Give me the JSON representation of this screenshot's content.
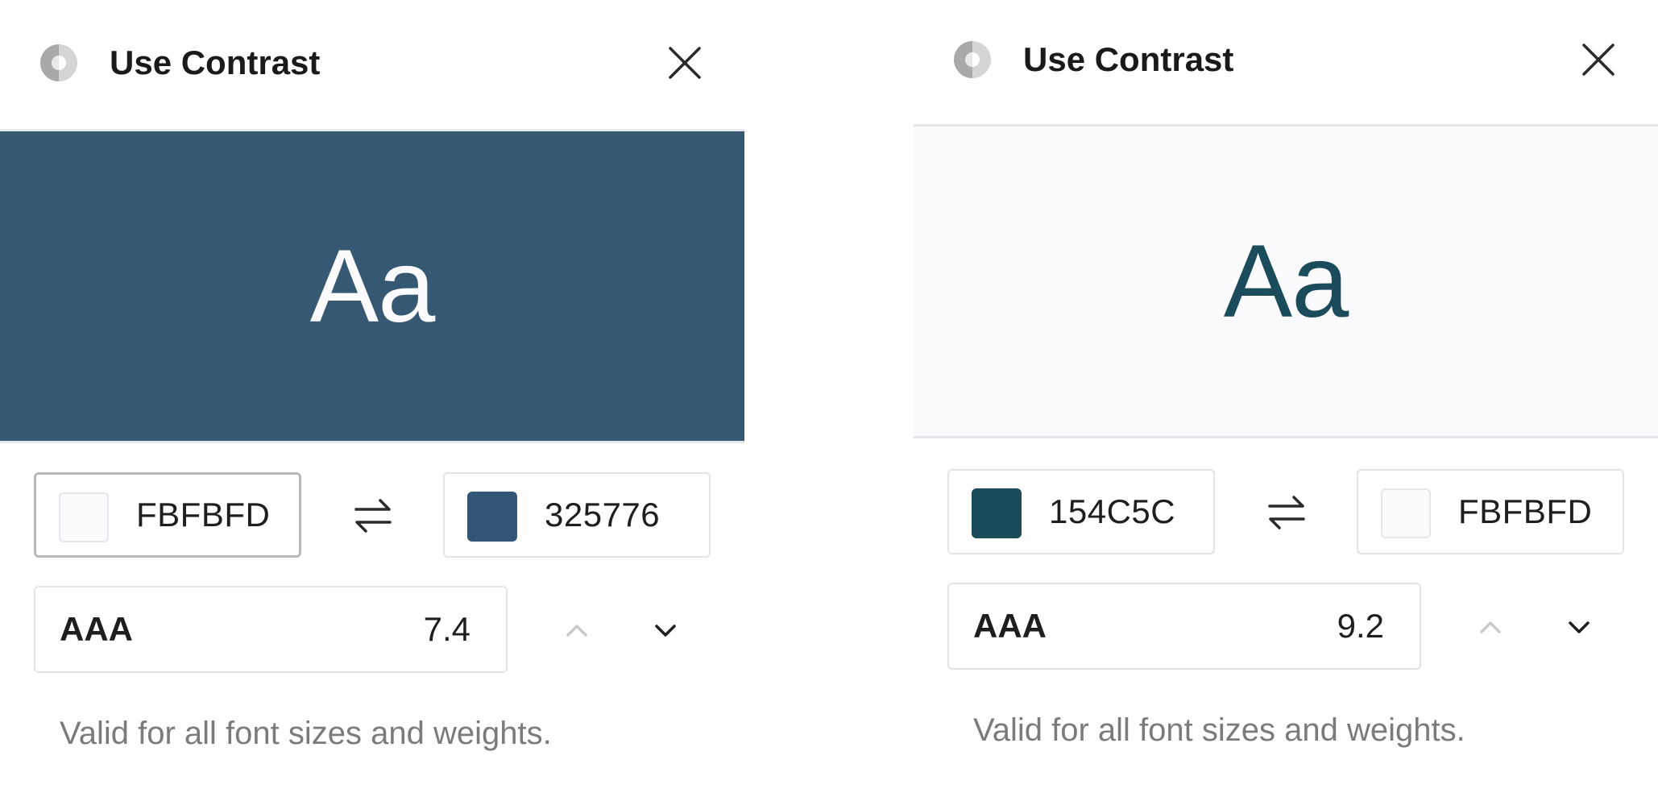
{
  "app": {
    "title": "Use Contrast"
  },
  "icons": {
    "logo": "contrast-logo-icon",
    "close": "close-icon",
    "swap": "swap-arrows-icon",
    "step_up": "chevron-up-icon",
    "step_down": "chevron-down-icon"
  },
  "panels": [
    {
      "preview_text": "Aa",
      "preview_bg": "#355873",
      "preview_fg": "#FBFBFD",
      "foreground": {
        "hex": "FBFBFD",
        "swatch": "#FBFBFD"
      },
      "background": {
        "hex": "325776",
        "swatch": "#325776"
      },
      "level": "AAA",
      "ratio": "7.4",
      "message": "Valid for all font sizes and weights."
    },
    {
      "preview_text": "Aa",
      "preview_bg": "#FBFBFD",
      "preview_fg": "#1A4C5B",
      "foreground": {
        "hex": "154C5C",
        "swatch": "#1A4C5B"
      },
      "background": {
        "hex": "FBFBFD",
        "swatch": "#FBFBFD"
      },
      "level": "AAA",
      "ratio": "9.2",
      "message": "Valid for all font sizes and weights."
    }
  ],
  "colors": {
    "text": "#1E1E1E",
    "muted_text": "#7B7B7B",
    "border": "#E3E4E7",
    "active_border": "#B9B9BC",
    "disabled_icon": "#C9CACD"
  }
}
